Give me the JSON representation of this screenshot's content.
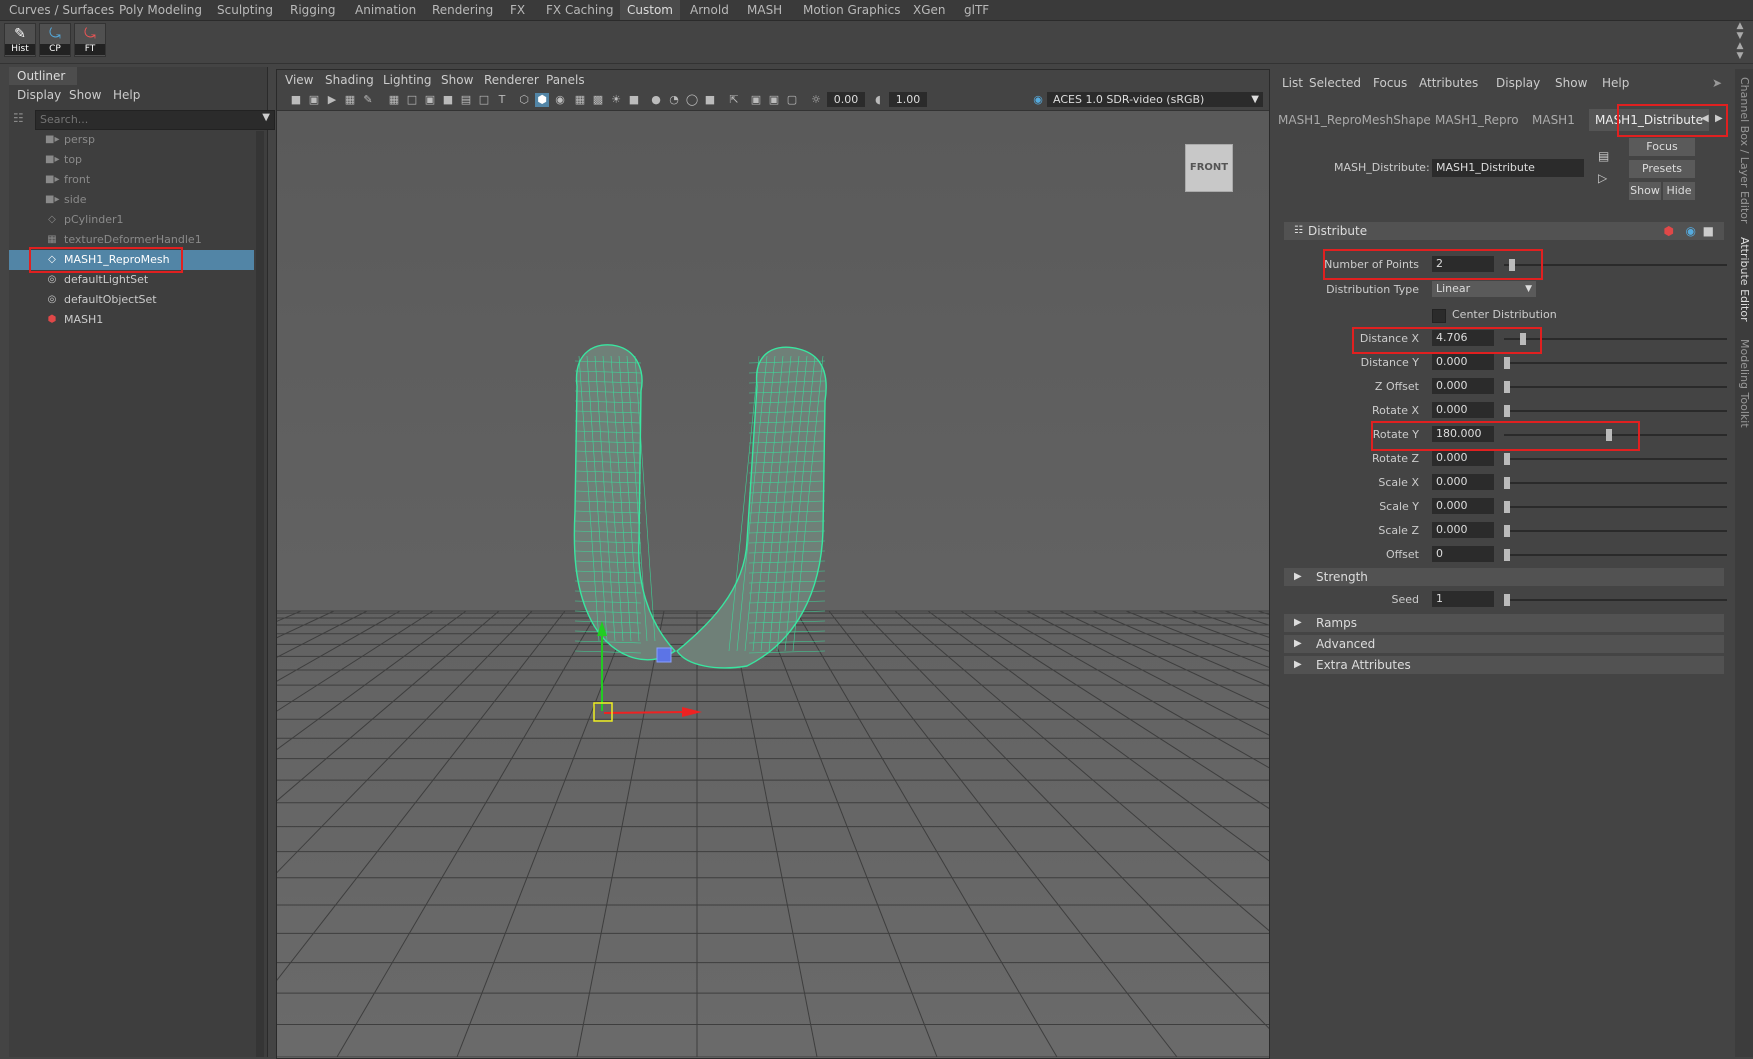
{
  "shelf_tabs": [
    "Curves / Surfaces",
    "Poly Modeling",
    "Sculpting",
    "Rigging",
    "Animation",
    "Rendering",
    "FX",
    "FX Caching",
    "Custom",
    "Arnold",
    "MASH",
    "Motion Graphics",
    "XGen",
    "glTF"
  ],
  "shelf_buttons": [
    "Hist",
    "CP",
    "FT"
  ],
  "outliner": {
    "title": "Outliner",
    "menu": [
      "Display",
      "Show",
      "Help"
    ],
    "search_placeholder": "Search...",
    "items": [
      {
        "label": "persp",
        "icon": "camera-icon"
      },
      {
        "label": "top",
        "icon": "camera-icon"
      },
      {
        "label": "front",
        "icon": "camera-icon"
      },
      {
        "label": "side",
        "icon": "camera-icon"
      },
      {
        "label": "pCylinder1",
        "icon": "mesh-icon"
      },
      {
        "label": "textureDeformerHandle1",
        "icon": "deformer-icon"
      },
      {
        "label": "MASH1_ReproMesh",
        "icon": "mesh-icon"
      },
      {
        "label": "defaultLightSet",
        "icon": "set-icon"
      },
      {
        "label": "defaultObjectSet",
        "icon": "set-icon"
      },
      {
        "label": "MASH1",
        "icon": "mash-icon"
      }
    ],
    "selected": "MASH1_ReproMesh"
  },
  "viewport": {
    "menu": [
      "View",
      "Shading",
      "Lighting",
      "Show",
      "Renderer",
      "Panels"
    ],
    "exposure": "0.00",
    "gamma": "1.00",
    "color_space": "ACES 1.0 SDR-video (sRGB)",
    "view_cube": "FRONT"
  },
  "attribute_editor": {
    "menu": [
      "List",
      "Selected",
      "Focus",
      "Attributes",
      "Display",
      "Show",
      "Help"
    ],
    "node_tabs": [
      "MASH1_ReproMeshShape",
      "MASH1_Repro",
      "MASH1",
      "MASH1_Distribute"
    ],
    "active_tab": "MASH1_Distribute",
    "node_type_label": "MASH_Distribute:",
    "node_name": "MASH1_Distribute",
    "buttons": {
      "focus": "Focus",
      "presets": "Presets",
      "show": "Show",
      "hide": "Hide"
    },
    "section_distribute": "Distribute",
    "number_of_points": {
      "label": "Number of Points",
      "value": "2"
    },
    "distribution_type": {
      "label": "Distribution Type",
      "value": "Linear"
    },
    "center_distribution": "Center Distribution",
    "distance_x": {
      "label": "Distance X",
      "value": "4.706"
    },
    "distance_y": {
      "label": "Distance Y",
      "value": "0.000"
    },
    "z_offset": {
      "label": "Z Offset",
      "value": "0.000"
    },
    "rotate_x": {
      "label": "Rotate X",
      "value": "0.000"
    },
    "rotate_y": {
      "label": "Rotate Y",
      "value": "180.000"
    },
    "rotate_z": {
      "label": "Rotate Z",
      "value": "0.000"
    },
    "scale_x": {
      "label": "Scale X",
      "value": "0.000"
    },
    "scale_y": {
      "label": "Scale Y",
      "value": "0.000"
    },
    "scale_z": {
      "label": "Scale Z",
      "value": "0.000"
    },
    "offset": {
      "label": "Offset",
      "value": "0"
    },
    "section_strength": "Strength",
    "seed": {
      "label": "Seed",
      "value": "1"
    },
    "section_ramps": "Ramps",
    "section_advanced": "Advanced",
    "section_extra": "Extra Attributes"
  },
  "side_tabs": [
    "Channel Box / Layer Editor",
    "Attribute Editor",
    "Modeling Toolkit"
  ],
  "colors": {
    "highlight": "#e02020",
    "selection": "#5285a6",
    "wireframe": "#39e6a0"
  }
}
